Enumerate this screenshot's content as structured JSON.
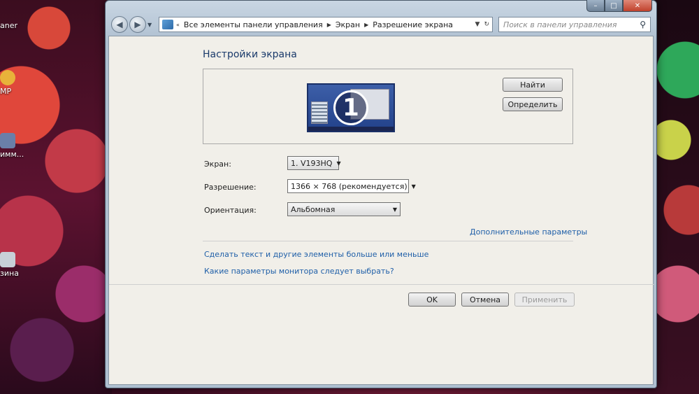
{
  "desktop": {
    "icons": [
      "aner",
      "MP",
      "имм...",
      "зина"
    ]
  },
  "window": {
    "caption": {
      "minimize": "–",
      "maximize": "□",
      "close": "✕"
    },
    "address": {
      "crumbs": [
        "Все элементы панели управления",
        "Экран",
        "Разрешение экрана"
      ]
    },
    "search": {
      "placeholder": "Поиск в панели управления"
    }
  },
  "display": {
    "heading": "Настройки экрана",
    "monitor_number": "1",
    "find_button": "Найти",
    "identify_button": "Определить",
    "screen": {
      "label": "Экран:",
      "value": "1. V193HQ"
    },
    "resolution": {
      "label": "Разрешение:",
      "value": "1366 × 768 (рекомендуется)"
    },
    "orientation": {
      "label": "Ориентация:",
      "value": "Альбомная"
    },
    "advanced_link": "Дополнительные параметры",
    "links": [
      "Сделать текст и другие элементы больше или меньше",
      "Какие параметры монитора следует выбрать?"
    ],
    "buttons": {
      "ok": "OK",
      "cancel": "Отмена",
      "apply": "Применить"
    }
  },
  "colors": {
    "link": "#1f5fa8",
    "heading": "#1a3a6b",
    "monitor_blue": "#2f4f9a"
  }
}
